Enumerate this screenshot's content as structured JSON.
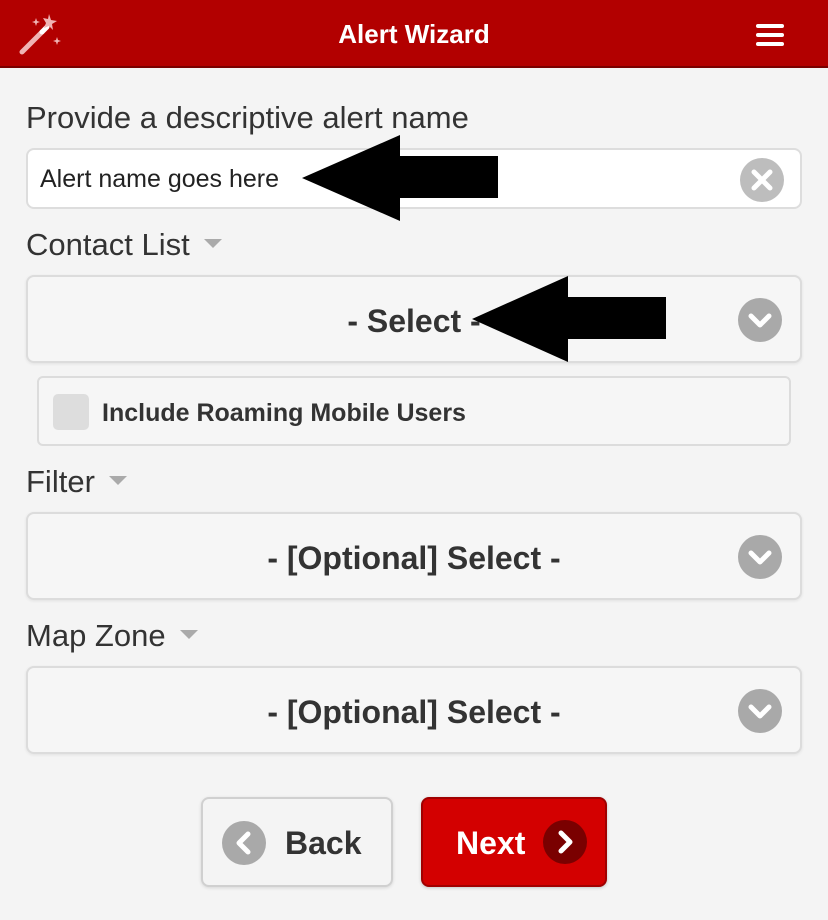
{
  "header": {
    "title": "Alert Wizard",
    "brand_color": "#b20000",
    "left_icon": "magic-wand-icon",
    "right_icon": "hamburger-menu-icon"
  },
  "alert_name": {
    "label": "Provide a descriptive alert name",
    "value": "Alert name goes here",
    "clear_icon": "clear-x-icon"
  },
  "contact_list": {
    "label": "Contact List",
    "selected": "- Select -"
  },
  "roaming": {
    "label": "Include Roaming Mobile Users",
    "checked": false
  },
  "filter": {
    "label": "Filter",
    "selected": "- [Optional] Select -"
  },
  "map_zone": {
    "label": "Map Zone",
    "selected": "- [Optional] Select -"
  },
  "buttons": {
    "back_label": "Back",
    "next_label": "Next",
    "next_color": "#d30000"
  },
  "annotations": {
    "arrow_color": "#000000",
    "arrow_icon": "arrow-left-icon"
  }
}
